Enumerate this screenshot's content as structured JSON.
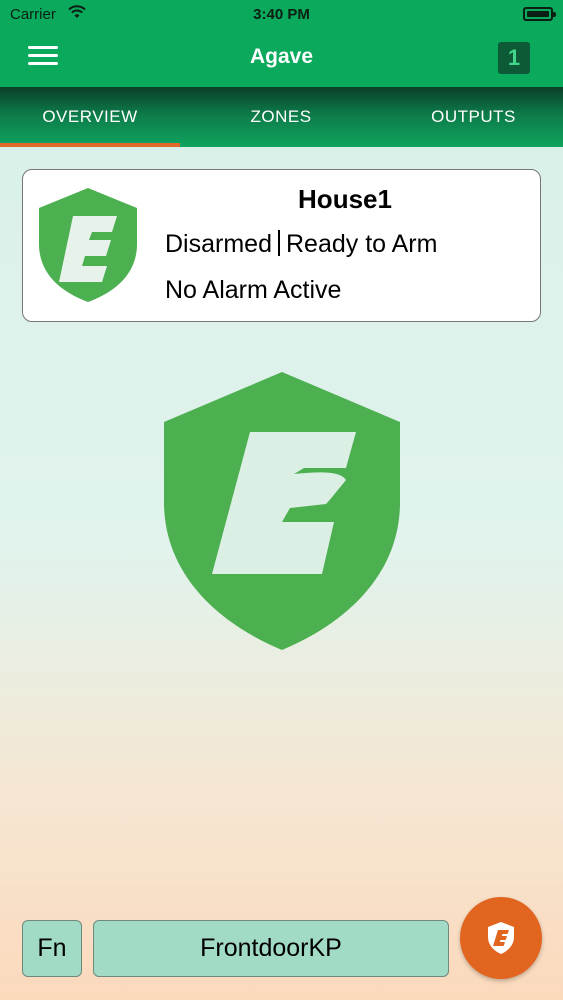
{
  "status_bar": {
    "carrier": "Carrier",
    "time": "3:40 PM",
    "icons": [
      "wifi-icon",
      "battery-icon"
    ]
  },
  "nav": {
    "title": "Agave",
    "badge": "1",
    "icons": [
      "hamburger-menu-icon"
    ]
  },
  "tabs": [
    {
      "label": "OVERVIEW",
      "active": true
    },
    {
      "label": "ZONES",
      "active": false
    },
    {
      "label": "OUTPUTS",
      "active": false
    }
  ],
  "card": {
    "name": "House1",
    "arm_state": "Disarmed",
    "ready_state": "Ready to Arm",
    "alarm_state": "No Alarm Active",
    "icon": "shield-e-logo-icon"
  },
  "bottom": {
    "fn_label": "Fn",
    "keypad_label": "FrontdoorKP",
    "fab_icon": "shield-e-icon"
  },
  "colors": {
    "primary_green": "#0aa95b",
    "shield_green": "#4caf50",
    "accent_orange": "#e2651f",
    "button_mint": "#a1dbc6"
  }
}
